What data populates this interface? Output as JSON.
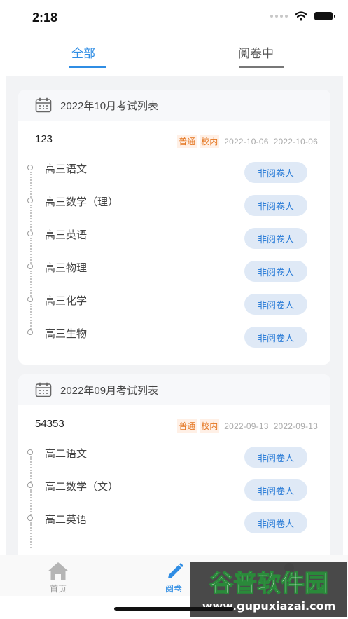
{
  "status_bar": {
    "time": "2:18"
  },
  "tabs": [
    {
      "label": "全部",
      "active": true
    },
    {
      "label": "阅卷中",
      "active": false
    }
  ],
  "badge_colors": {
    "accent": "#2f8de4",
    "badge_text": "#e4751f",
    "badge_bg": "#fff0e6"
  },
  "sections": [
    {
      "title": "2022年10月考试列表",
      "exam": {
        "name": "123",
        "tags": [
          "普通",
          "校内"
        ],
        "start_date": "2022-10-06",
        "end_date": "2022-10-06",
        "subjects": [
          {
            "name": "高三语文",
            "button": "非阅卷人"
          },
          {
            "name": "高三数学（理）",
            "button": "非阅卷人"
          },
          {
            "name": "高三英语",
            "button": "非阅卷人"
          },
          {
            "name": "高三物理",
            "button": "非阅卷人"
          },
          {
            "name": "高三化学",
            "button": "非阅卷人"
          },
          {
            "name": "高三生物",
            "button": "非阅卷人"
          }
        ]
      }
    },
    {
      "title": "2022年09月考试列表",
      "exam": {
        "name": "54353",
        "tags": [
          "普通",
          "校内"
        ],
        "start_date": "2022-09-13",
        "end_date": "2022-09-13",
        "subjects": [
          {
            "name": "高二语文",
            "button": "非阅卷人"
          },
          {
            "name": "高二数学（文）",
            "button": "非阅卷人"
          },
          {
            "name": "高二英语",
            "button": "非阅卷人"
          }
        ]
      }
    }
  ],
  "bottom_nav": [
    {
      "label": "首页",
      "icon": "home-icon"
    },
    {
      "label": "阅卷",
      "icon": "pencil-icon"
    },
    {
      "label": "",
      "icon": "user-icon"
    }
  ],
  "watermark": {
    "brand": "谷普软件园",
    "url": "www.gupuxiazai.com"
  }
}
